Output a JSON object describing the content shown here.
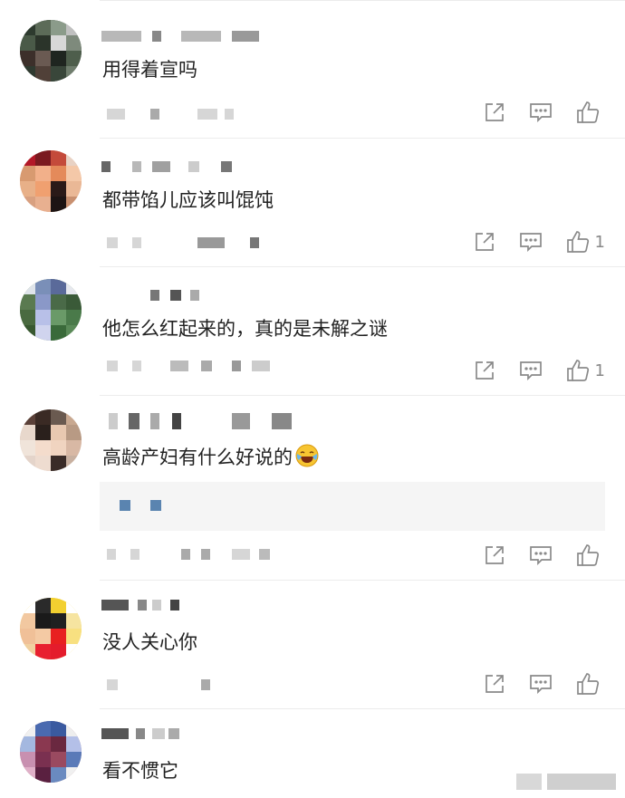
{
  "comments": [
    {
      "text": "用得着宣吗",
      "like_count": ""
    },
    {
      "text": "都带馅儿应该叫馄饨",
      "like_count": "1"
    },
    {
      "text": "他怎么红起来的，真的是未解之谜",
      "like_count": "1"
    },
    {
      "text": "高龄产妇有什么好说的",
      "like_count": "",
      "emoji": "laughing-crying-emoji"
    },
    {
      "text": "没人关心你",
      "like_count": ""
    },
    {
      "text": "看不惯它",
      "like_count": ""
    }
  ],
  "icons": {
    "share": "share-icon",
    "reply": "reply-icon",
    "like": "thumbs-up-icon"
  },
  "colors": {
    "icon": "#8a8a8a",
    "quote_accent": "#5a84b0"
  }
}
